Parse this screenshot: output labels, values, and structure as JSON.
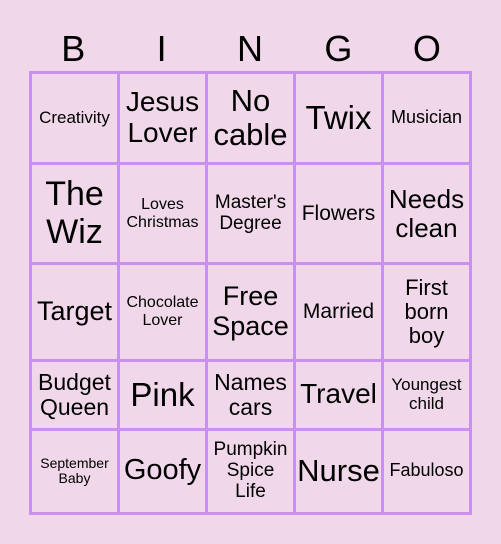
{
  "header": [
    "B",
    "I",
    "N",
    "G",
    "O"
  ],
  "cells": [
    [
      {
        "t": "Creativity",
        "s": 17
      },
      {
        "t": "Jesus Lover",
        "s": 28
      },
      {
        "t": "No cable",
        "s": 31
      },
      {
        "t": "Twix",
        "s": 33
      },
      {
        "t": "Musician",
        "s": 18
      }
    ],
    [
      {
        "t": "The Wiz",
        "s": 34
      },
      {
        "t": "Loves Christmas",
        "s": 16
      },
      {
        "t": "Master's Degree",
        "s": 19
      },
      {
        "t": "Flowers",
        "s": 21
      },
      {
        "t": "Needs clean",
        "s": 26
      }
    ],
    [
      {
        "t": "Target",
        "s": 27
      },
      {
        "t": "Chocolate Lover",
        "s": 16
      },
      {
        "t": "Free Space",
        "s": 27
      },
      {
        "t": "Married",
        "s": 21
      },
      {
        "t": "First born boy",
        "s": 22
      }
    ],
    [
      {
        "t": "Budget Queen",
        "s": 23
      },
      {
        "t": "Pink",
        "s": 33
      },
      {
        "t": "Names cars",
        "s": 23
      },
      {
        "t": "Travel",
        "s": 28
      },
      {
        "t": "Youngest child",
        "s": 17
      }
    ],
    [
      {
        "t": "September Baby",
        "s": 14
      },
      {
        "t": "Goofy",
        "s": 29
      },
      {
        "t": "Pumpkin Spice Life",
        "s": 19
      },
      {
        "t": "Nurse",
        "s": 31
      },
      {
        "t": "Fabuloso",
        "s": 18
      }
    ]
  ]
}
